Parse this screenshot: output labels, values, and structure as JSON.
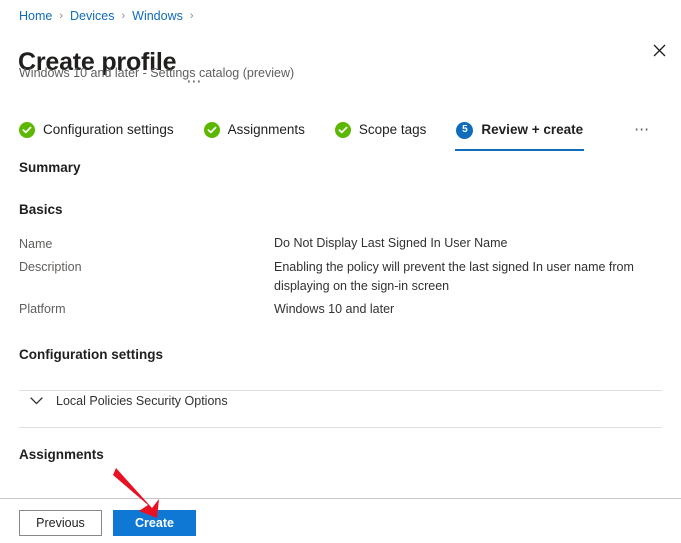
{
  "breadcrumb": {
    "items": [
      {
        "label": "Home"
      },
      {
        "label": "Devices"
      },
      {
        "label": "Windows"
      }
    ],
    "separator": "›"
  },
  "header": {
    "title": "Create profile",
    "title_more": "⋯",
    "subtitle": "Windows 10 and later - Settings catalog (preview)",
    "close_icon": "close-icon"
  },
  "tabs": {
    "items": [
      {
        "label": "Configuration settings",
        "state": "complete",
        "badge": "✓"
      },
      {
        "label": "Assignments",
        "state": "complete",
        "badge": "✓"
      },
      {
        "label": "Scope tags",
        "state": "complete",
        "badge": "✓"
      },
      {
        "label": "Review + create",
        "state": "active",
        "badge": "5"
      }
    ],
    "overflow": "⋯"
  },
  "summary": {
    "heading": "Summary",
    "basics": {
      "heading": "Basics",
      "rows": [
        {
          "label": "Name",
          "value": "Do Not Display Last Signed In User Name"
        },
        {
          "label": "Description",
          "value": "Enabling the policy will prevent the last signed In user name from displaying on the sign-in screen"
        },
        {
          "label": "Platform",
          "value": "Windows 10 and later"
        }
      ]
    },
    "configuration_settings": {
      "heading": "Configuration settings",
      "group": {
        "label": "Local Policies Security Options",
        "expanded": false,
        "chevron": "chevron-down-icon"
      }
    },
    "assignments": {
      "heading": "Assignments"
    }
  },
  "footer": {
    "previous_label": "Previous",
    "create_label": "Create"
  },
  "annotation": {
    "arrow": "red-arrow-pointing-to-create-button",
    "color": "#e81123"
  },
  "colors": {
    "link": "#0f6cbd",
    "accent": "#0f78d4",
    "success": "#5bb700",
    "text": "#201f1e",
    "muted": "#605e5c",
    "divider": "#e1dfdd"
  }
}
